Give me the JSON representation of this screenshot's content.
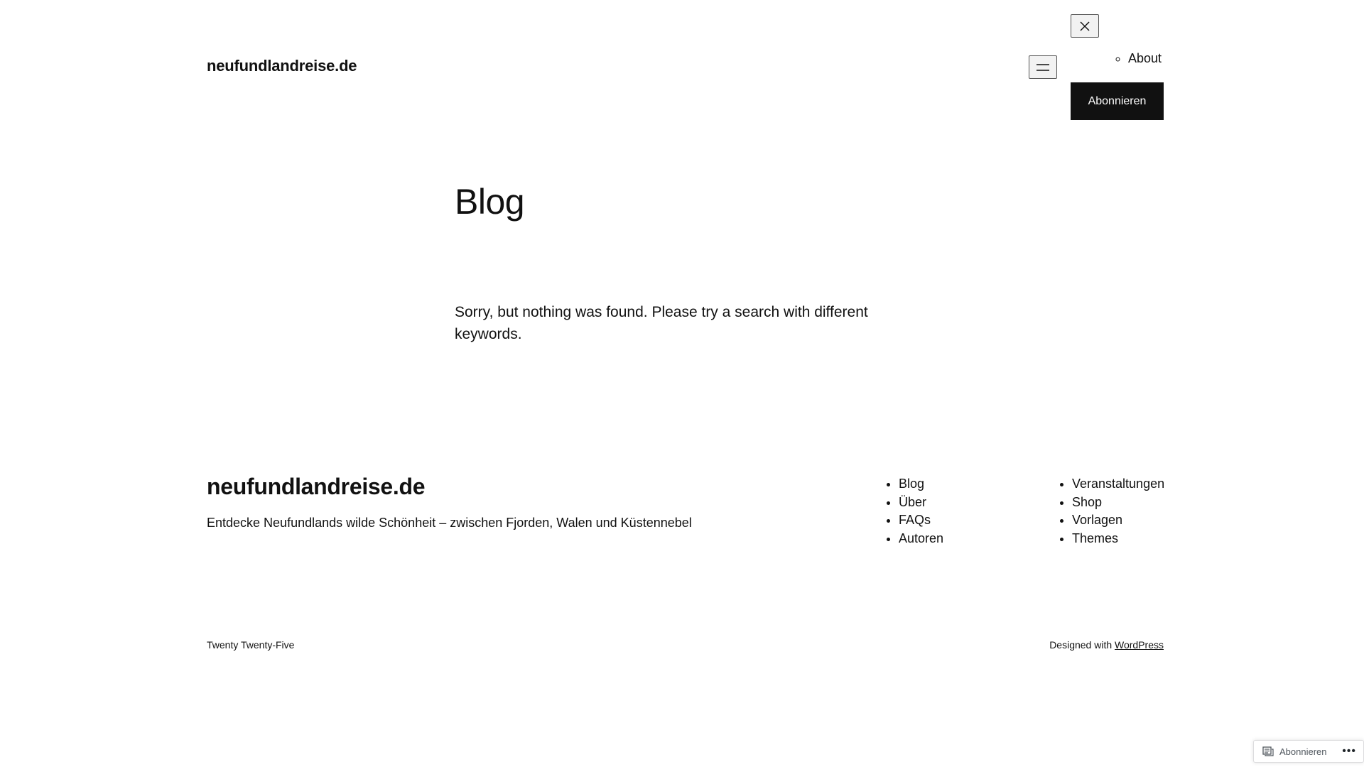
{
  "header": {
    "site_title": "neufundlandreise.de",
    "menu_open_icon": "hamburger-icon",
    "menu_close_icon": "close-icon",
    "nav_items": [
      {
        "label": "About"
      }
    ],
    "subscribe_label": "Abonnieren"
  },
  "main": {
    "title": "Blog",
    "no_results_text": "Sorry, but nothing was found. Please try a search with different keywords."
  },
  "footer": {
    "site_title": "neufundlandreise.de",
    "tagline": "Entdecke Neufundlands wilde Schönheit – zwischen Fjorden, Walen und Küstennebel",
    "nav_col1": [
      "Blog",
      "Über",
      "FAQs",
      "Autoren"
    ],
    "nav_col2": [
      "Veranstaltungen",
      "Shop",
      "Vorlagen",
      "Themes"
    ],
    "theme_name": "Twenty Twenty-Five",
    "credit_prefix": "Designed with",
    "credit_link": "WordPress"
  },
  "floating_bar": {
    "subscribe_label": "Abonnieren",
    "subscribe_icon": "reader-icon",
    "more_icon": "ellipsis-icon",
    "more_glyph": "•••"
  },
  "colors": {
    "text": "#111111",
    "button_bg": "#111111",
    "button_text": "#ffffff",
    "background": "#ffffff"
  }
}
